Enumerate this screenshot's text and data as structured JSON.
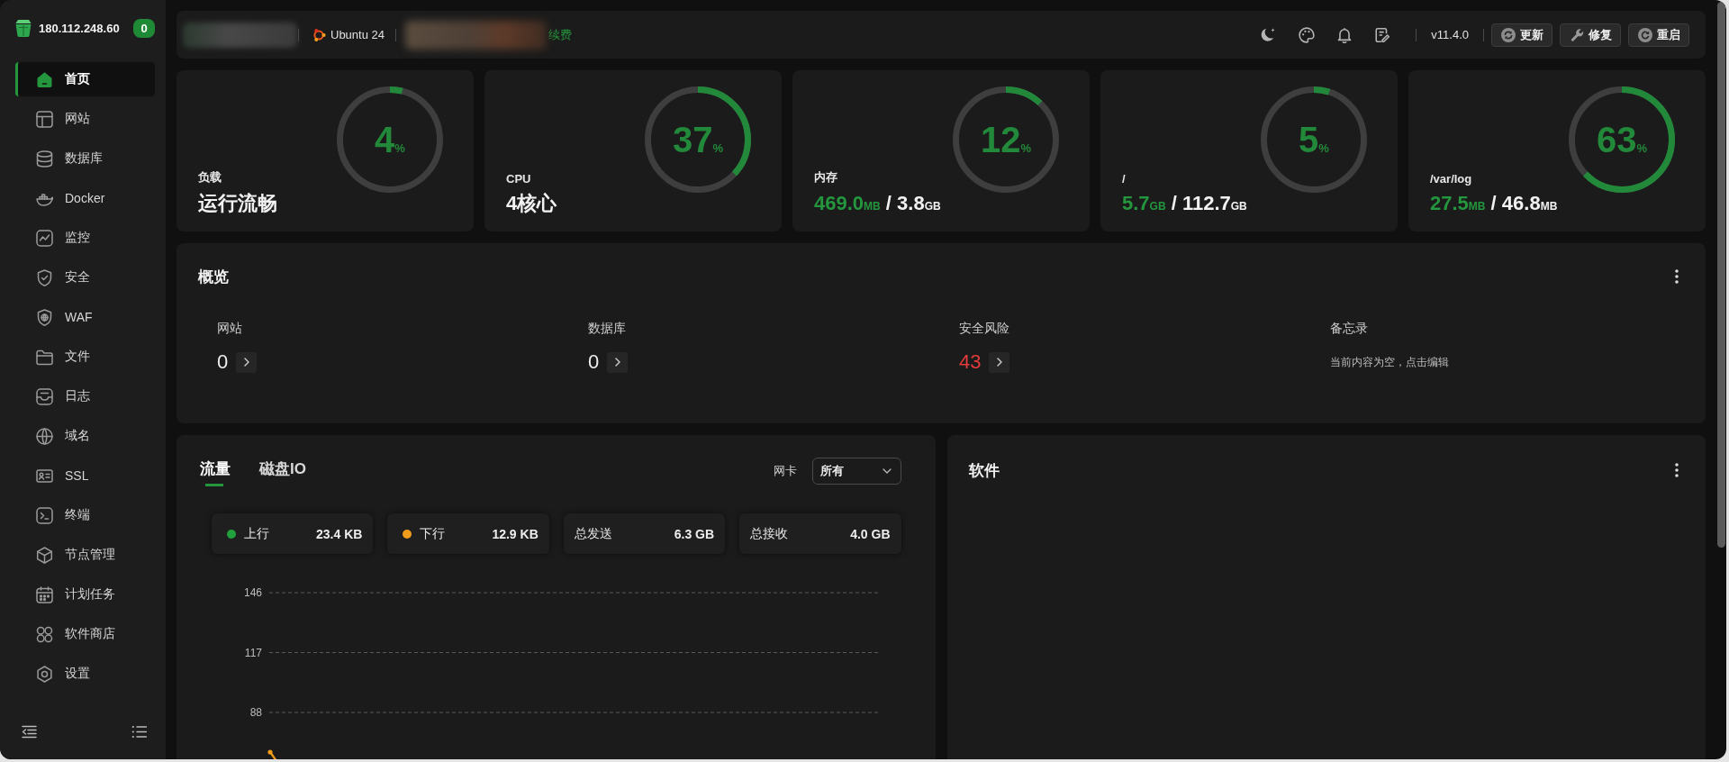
{
  "sidebar": {
    "host": "180.112.248.60",
    "badge": "0",
    "items": [
      {
        "label": "首页",
        "selected": true
      },
      {
        "label": "网站",
        "selected": false
      },
      {
        "label": "数据库",
        "selected": false
      },
      {
        "label": "Docker",
        "selected": false
      },
      {
        "label": "监控",
        "selected": false
      },
      {
        "label": "安全",
        "selected": false
      },
      {
        "label": "WAF",
        "selected": false
      },
      {
        "label": "文件",
        "selected": false
      },
      {
        "label": "日志",
        "selected": false
      },
      {
        "label": "域名",
        "selected": false
      },
      {
        "label": "SSL",
        "selected": false
      },
      {
        "label": "终端",
        "selected": false
      },
      {
        "label": "节点管理",
        "selected": false
      },
      {
        "label": "计划任务",
        "selected": false
      },
      {
        "label": "软件商店",
        "selected": false
      },
      {
        "label": "设置",
        "selected": false
      }
    ]
  },
  "top_bar": {
    "os": "Ubuntu 24",
    "renew_link": "续费",
    "version": "v11.4.0",
    "buttons": [
      "更新",
      "修复",
      "重启"
    ]
  },
  "stats": [
    {
      "kind": "status",
      "label": "负载",
      "percent": "4",
      "unit": "%",
      "level": 0.04,
      "value": "运行流畅"
    },
    {
      "kind": "status",
      "label": "CPU",
      "percent": "37",
      "unit": "%",
      "level": 0.37,
      "value": "4核心"
    },
    {
      "kind": "usage",
      "label": "内存",
      "percent": "12",
      "unit": "%",
      "level": 0.12,
      "used": "469.0",
      "used_unit": "MB",
      "separator": "/",
      "total": "3.8",
      "total_unit": "GB"
    },
    {
      "kind": "usage",
      "label": "/",
      "percent": "5",
      "unit": "%",
      "level": 0.05,
      "used": "5.7",
      "used_unit": "GB",
      "separator": "/",
      "total": "112.7",
      "total_unit": "GB"
    },
    {
      "kind": "usage",
      "label": "/var/log",
      "percent": "63",
      "unit": "%",
      "level": 0.63,
      "used": "27.5",
      "used_unit": "MB",
      "separator": "/",
      "total": "46.8",
      "total_unit": "MB"
    }
  ],
  "overview": {
    "title": "概览",
    "items": [
      {
        "kind": "count",
        "label": "网站",
        "value": "0"
      },
      {
        "kind": "count",
        "label": "数据库",
        "value": "0"
      },
      {
        "kind": "risk",
        "label": "安全风险",
        "value": "43"
      },
      {
        "kind": "memo",
        "label": "备忘录",
        "value": "当前内容为空，点击编辑"
      }
    ]
  },
  "traffic": {
    "tabs": [
      {
        "label": "流量",
        "selected": true
      },
      {
        "label": "磁盘IO",
        "selected": false
      }
    ],
    "nic_label": "网卡",
    "nic_value": "所有",
    "stats": [
      {
        "label": "上行",
        "value": "23.4 KB",
        "color": "#22a03c"
      },
      {
        "label": "下行",
        "value": "12.9 KB",
        "color": "#f29c1b"
      },
      {
        "label": "总发送",
        "value": "6.3 GB"
      },
      {
        "label": "总接收",
        "value": "4.0 GB"
      }
    ],
    "y_tick_labels": [
      "146",
      "117",
      "88"
    ]
  },
  "software": {
    "title": "软件"
  }
}
